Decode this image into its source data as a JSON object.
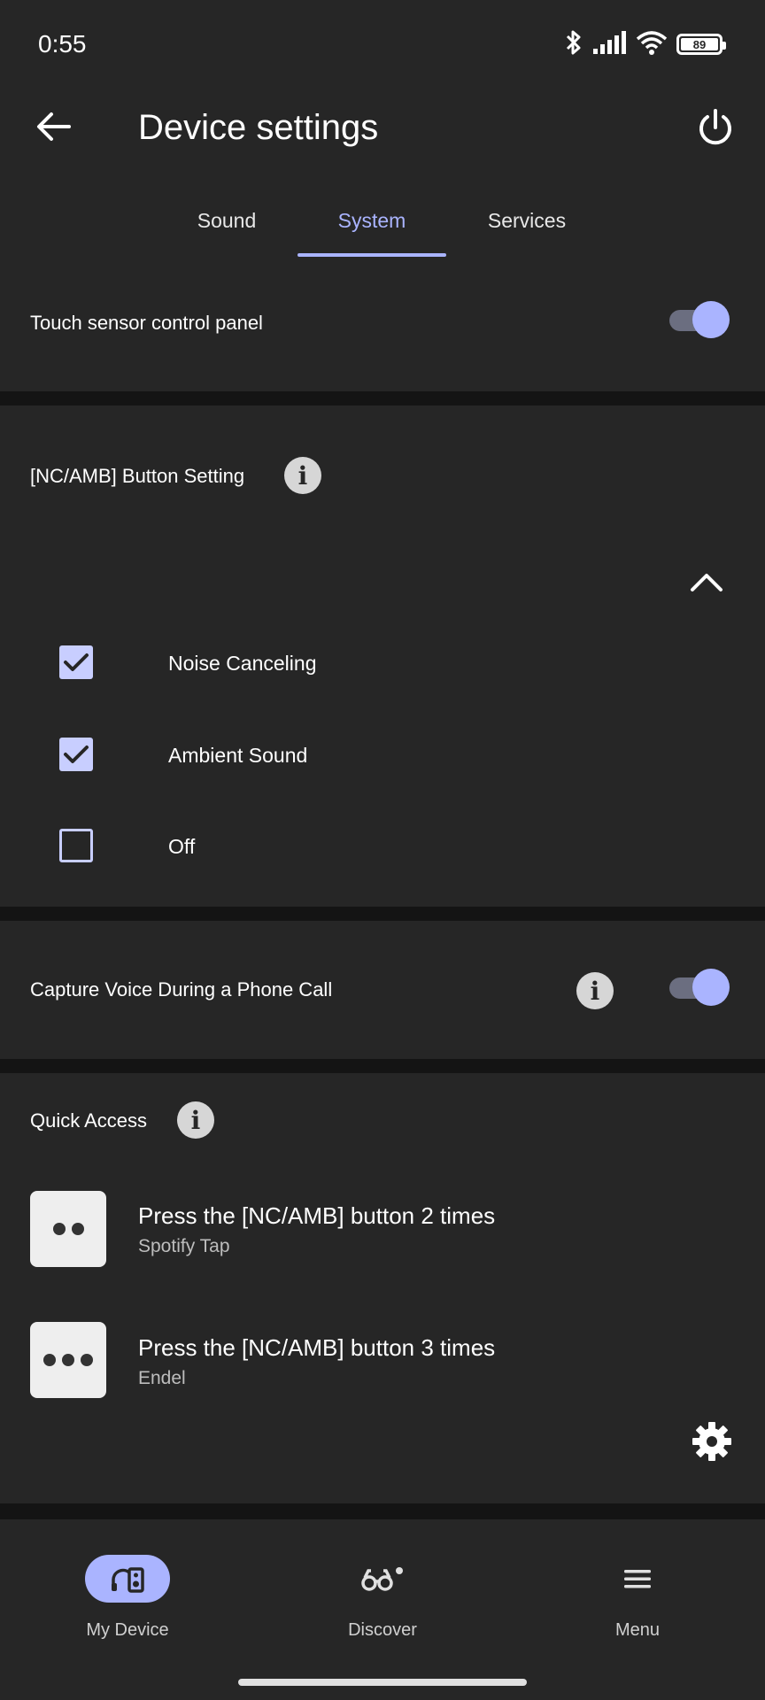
{
  "status_bar": {
    "time": "0:55",
    "battery_level": "89",
    "icons": [
      "bluetooth-icon",
      "signal-icon",
      "wifi-icon",
      "battery-icon"
    ]
  },
  "app_bar": {
    "title": "Device settings",
    "back_icon": "arrow-left-icon",
    "power_icon": "power-icon"
  },
  "tabs": [
    {
      "label": "Sound",
      "active": false
    },
    {
      "label": "System",
      "active": true
    },
    {
      "label": "Services",
      "active": false
    }
  ],
  "touch_sensor": {
    "label": "Touch sensor control panel",
    "enabled": true
  },
  "nc_amb_setting": {
    "label": "[NC/AMB] Button Setting",
    "expanded": true,
    "options": [
      {
        "label": "Noise Canceling",
        "checked": true
      },
      {
        "label": "Ambient Sound",
        "checked": true
      },
      {
        "label": "Off",
        "checked": false
      }
    ]
  },
  "capture_voice": {
    "label": "Capture Voice During a Phone Call",
    "enabled": true
  },
  "quick_access": {
    "label": "Quick Access",
    "items": [
      {
        "title": "Press the [NC/AMB] button 2 times",
        "subtitle": "Spotify Tap",
        "dots": 2
      },
      {
        "title": "Press the [NC/AMB] button 3 times",
        "subtitle": "Endel",
        "dots": 3
      }
    ]
  },
  "bottom_nav": [
    {
      "label": "My Device",
      "icon": "headphones-device-icon",
      "active": true
    },
    {
      "label": "Discover",
      "icon": "binoculars-icon",
      "active": false
    },
    {
      "label": "Menu",
      "icon": "hamburger-menu-icon",
      "active": false
    }
  ],
  "colors": {
    "background": "#262626",
    "divider": "#141414",
    "accent": "#aab4ff",
    "text": "#ffffff"
  }
}
